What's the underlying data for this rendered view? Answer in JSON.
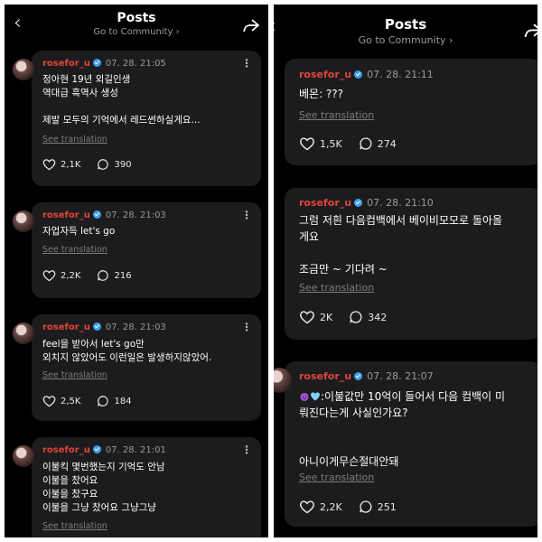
{
  "left_panel": {
    "title": "Posts",
    "subtitle": "Go to Community ›",
    "posts": [
      {
        "user": "rosefor_u",
        "time": "07. 28. 21:05",
        "text": "정아현 19년 외길인생\n역대급 흑역사 생성\n\n제발 모두의 기억에서 레드썬하실게요...",
        "see_translation": "See translation",
        "likes": "2,1K",
        "comments": "390"
      },
      {
        "user": "rosefor_u",
        "time": "07. 28. 21:03",
        "text": "자업자득 let's go",
        "see_translation": "See translation",
        "likes": "2,2K",
        "comments": "216"
      },
      {
        "user": "rosefor_u",
        "time": "07. 28. 21:03",
        "text": "feel을 받아서 let's go만\n외치지 않았어도 이런일은 발생하지않았어.",
        "see_translation": "See translation",
        "likes": "2,5K",
        "comments": "184"
      },
      {
        "user": "rosefor_u",
        "time": "07. 28. 21:01",
        "text": "이불킥 몇번했는지 기억도 안남\n이불을 찼어요\n이불을 찼구요\n이불을 그냥 찼어요 그냥그냥",
        "see_translation": "See translation"
      }
    ]
  },
  "right_panel": {
    "title": "Posts",
    "subtitle": "Go to Community ›",
    "posts": [
      {
        "user": "rosefor_u",
        "time": "07. 28. 21:11",
        "text": "베몬: ???",
        "see_translation": "See translation",
        "likes": "1,5K",
        "comments": "274"
      },
      {
        "user": "rosefor_u",
        "time": "07. 28. 21:10",
        "text": "그럼 저흰 다음컴백에서 베이비모모로 돌아올\n게요\n\n조금만 ~ 기다려 ~",
        "see_translation": "See translation",
        "likes": "2K",
        "comments": "342"
      },
      {
        "user": "rosefor_u",
        "time": "07. 28. 21:07",
        "text_line1": ":이불값만 10억이 들어서 다음 컴백이 미",
        "text_rest": "뤄진다는게 사실인가요?\n\n\n아니이게무슨절대안돼",
        "see_translation": "See translation",
        "likes": "2,2K",
        "comments": "251"
      }
    ]
  },
  "icons": {
    "back": "chevron-left-icon",
    "share": "share-arrow-icon",
    "like": "heart-icon",
    "comment": "comment-bubble-icon",
    "more": "more-vertical-icon"
  },
  "colors": {
    "background": "#000000",
    "card": "#1c1c1e",
    "username": "#e0453a",
    "verified": "#3aa0f2"
  }
}
